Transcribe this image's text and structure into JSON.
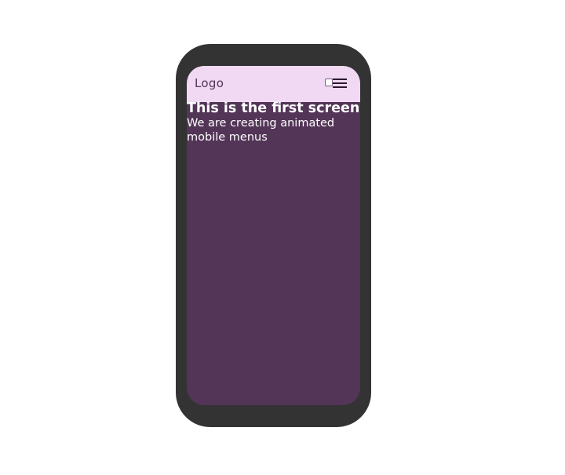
{
  "navbar": {
    "logo": "Logo",
    "menu_icon": "hamburger-icon"
  },
  "screen": {
    "title": "This is the first screen",
    "subtitle": "We are creating animated mobile menus"
  },
  "colors": {
    "device_frame": "#333333",
    "screen_background": "#533557",
    "navbar_background": "#f1d8f3"
  }
}
